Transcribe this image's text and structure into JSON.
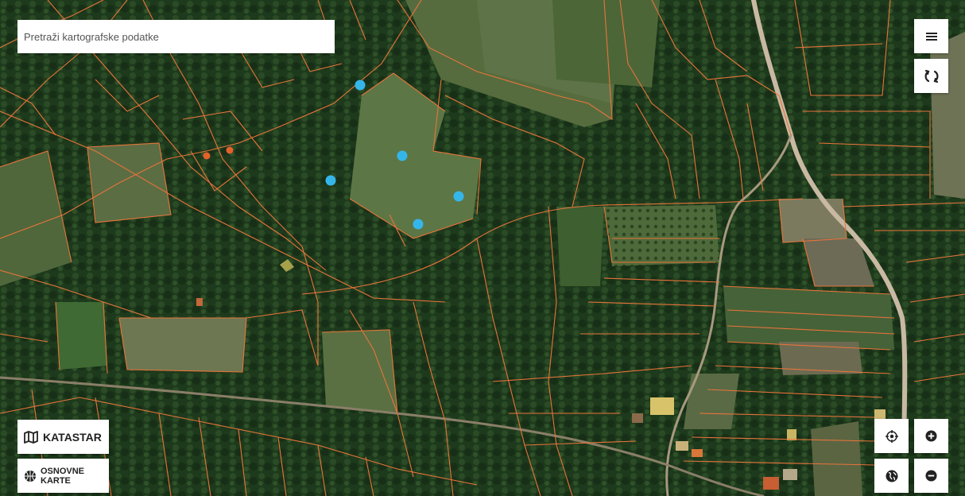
{
  "search": {
    "placeholder": "Pretraži kartografske podatke"
  },
  "top_right": {
    "menu_icon": "hamburger-menu-icon",
    "refresh_icon": "sync-icon"
  },
  "layers": {
    "katastar_label": "KATASTAR",
    "osnovne_karte_label": "OSNOVNE KARTE",
    "katastar_icon": "map-icon",
    "osnovne_icon": "basketball-globe-icon"
  },
  "map_controls": {
    "locate_icon": "crosshair-icon",
    "zoom_in_icon": "plus-icon",
    "globe_icon": "globe-icon",
    "zoom_out_icon": "minus-icon"
  },
  "colors": {
    "parcel_line": "#e8743b",
    "poi_blue": "#35b6ea",
    "poi_orange": "#e5612a",
    "vegetation_dark": "#1f3a1d",
    "field": "#5a7040",
    "road": "#c9b9a3"
  },
  "poi_markers": [
    {
      "type": "blue"
    },
    {
      "type": "blue"
    },
    {
      "type": "blue"
    },
    {
      "type": "blue"
    },
    {
      "type": "blue"
    },
    {
      "type": "orange"
    },
    {
      "type": "orange"
    }
  ]
}
